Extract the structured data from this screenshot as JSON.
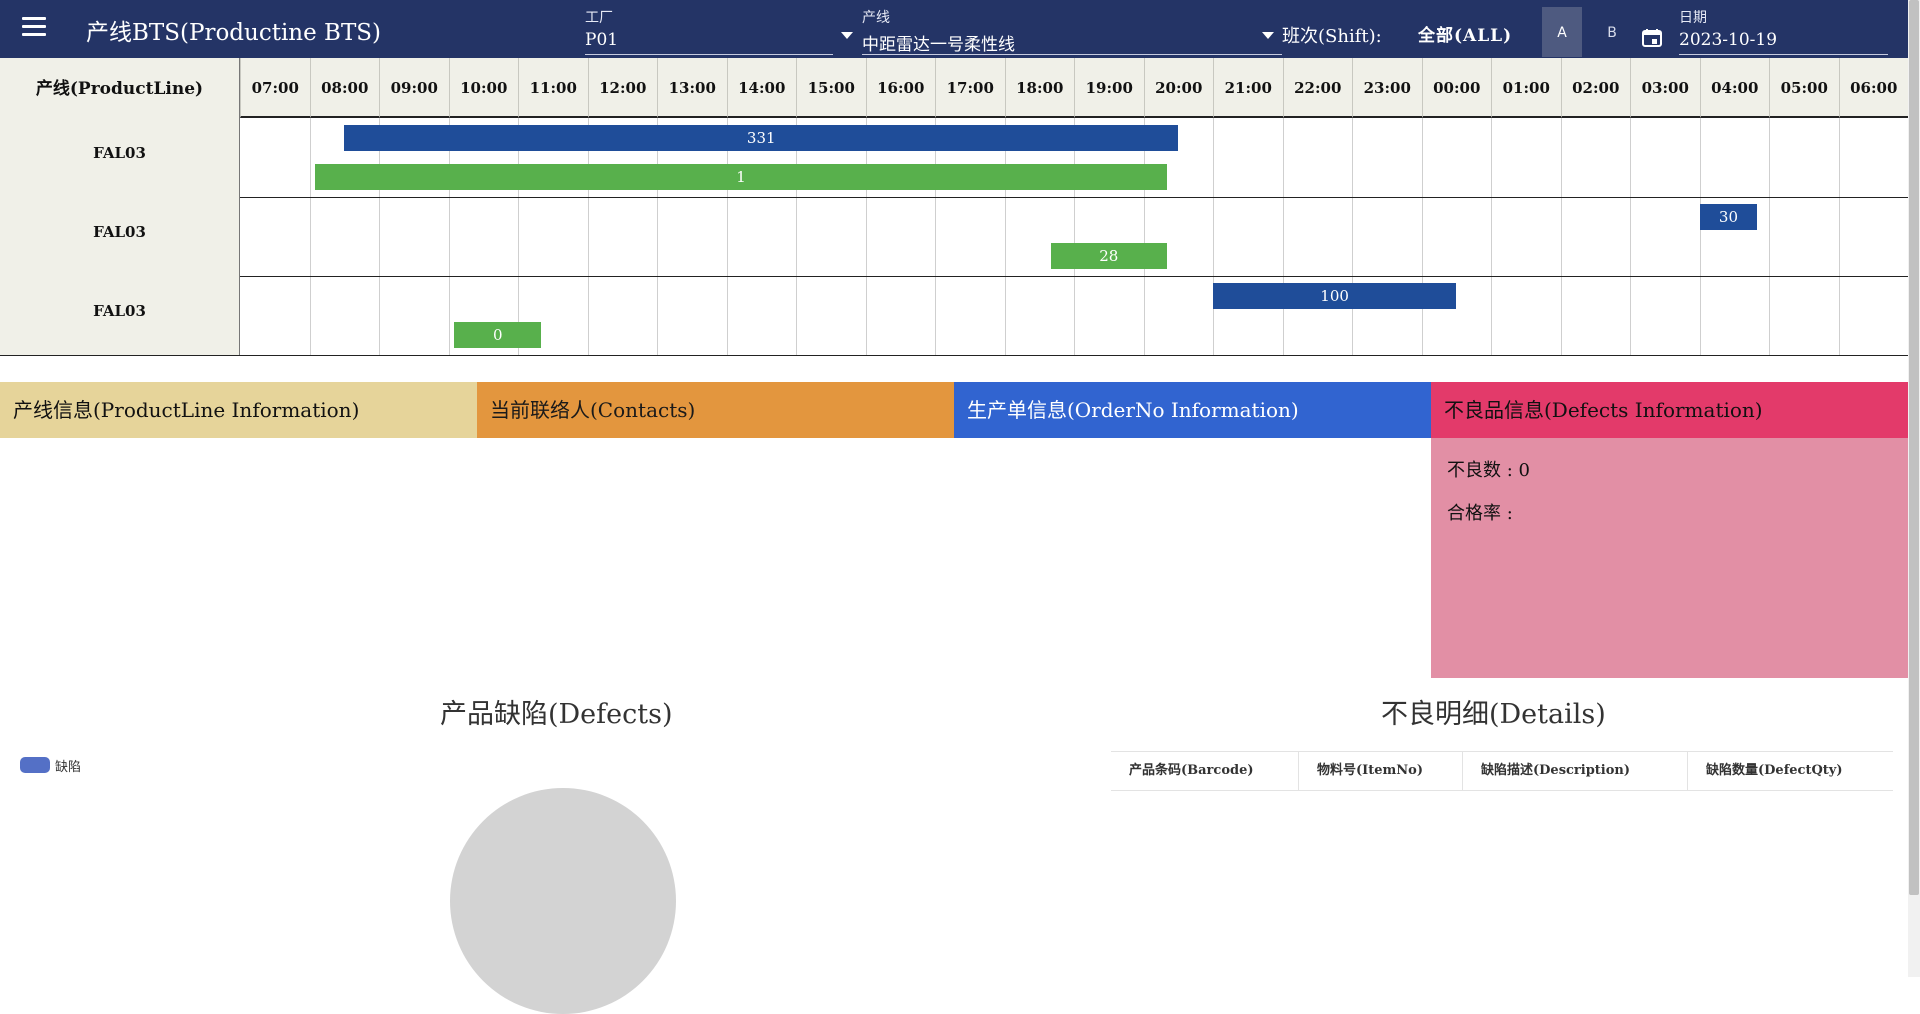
{
  "header": {
    "title": "产线BTS(Productine BTS)",
    "factory": {
      "label": "工厂",
      "value": "P01"
    },
    "productline": {
      "label": "产线",
      "value": "中距雷达一号柔性线"
    },
    "shift": {
      "label": "班次(Shift):",
      "all": "全部(ALL)",
      "a": "A",
      "b": "B",
      "selected": "A"
    },
    "date": {
      "label": "日期",
      "value": "2023-10-19"
    },
    "menu_icon": "menu-icon",
    "calendar_icon": "calendar-icon",
    "bar_color": "#243466"
  },
  "gantt": {
    "corner_label": "产线(ProductLine)",
    "hours": [
      "07:00",
      "08:00",
      "09:00",
      "10:00",
      "11:00",
      "12:00",
      "13:00",
      "14:00",
      "15:00",
      "16:00",
      "17:00",
      "18:00",
      "19:00",
      "20:00",
      "21:00",
      "22:00",
      "23:00",
      "00:00",
      "01:00",
      "02:00",
      "03:00",
      "04:00",
      "05:00",
      "06:00"
    ],
    "rows": [
      {
        "label": "FAL03",
        "bars": [
          {
            "value": "331",
            "color": "blue",
            "start": "08:30",
            "end": "20:30"
          },
          {
            "value": "1",
            "color": "green",
            "start": "08:05",
            "end": "20:20"
          }
        ]
      },
      {
        "label": "FAL03",
        "bars": [
          {
            "value": "30",
            "color": "blue",
            "start": "04:00",
            "end": "04:50"
          },
          {
            "value": "28",
            "color": "green",
            "start": "18:40",
            "end": "20:20"
          }
        ]
      },
      {
        "label": "FAL03",
        "bars": [
          {
            "value": "100",
            "color": "blue",
            "start": "21:00",
            "end": "00:30"
          },
          {
            "value": "0",
            "color": "green",
            "start": "10:05",
            "end": "11:20"
          }
        ]
      }
    ],
    "colors": {
      "blue": "#1f4d99",
      "green": "#58b04c"
    }
  },
  "panels": {
    "productline": "产线信息(ProductLine Information)",
    "contacts": "当前联络人(Contacts)",
    "orderno": "生产单信息(OrderNo Information)",
    "defects": "不良品信息(Defects Information)",
    "defect_count": "不良数 : 0",
    "pass_rate": "合格率 :",
    "colors": {
      "productline": "#e6d49a",
      "contacts": "#e3963e",
      "orderno": "#3164d0",
      "defects": "#e33a6a"
    }
  },
  "defects_chart": {
    "title": "产品缺陷(Defects)",
    "legend": "缺陷",
    "legend_color": "#5470c6"
  },
  "details": {
    "title": "不良明细(Details)",
    "columns": [
      "产品条码(Barcode)",
      "物料号(ItemNo)",
      "缺陷描述(Description)",
      "缺陷数量(DefectQty)"
    ]
  }
}
